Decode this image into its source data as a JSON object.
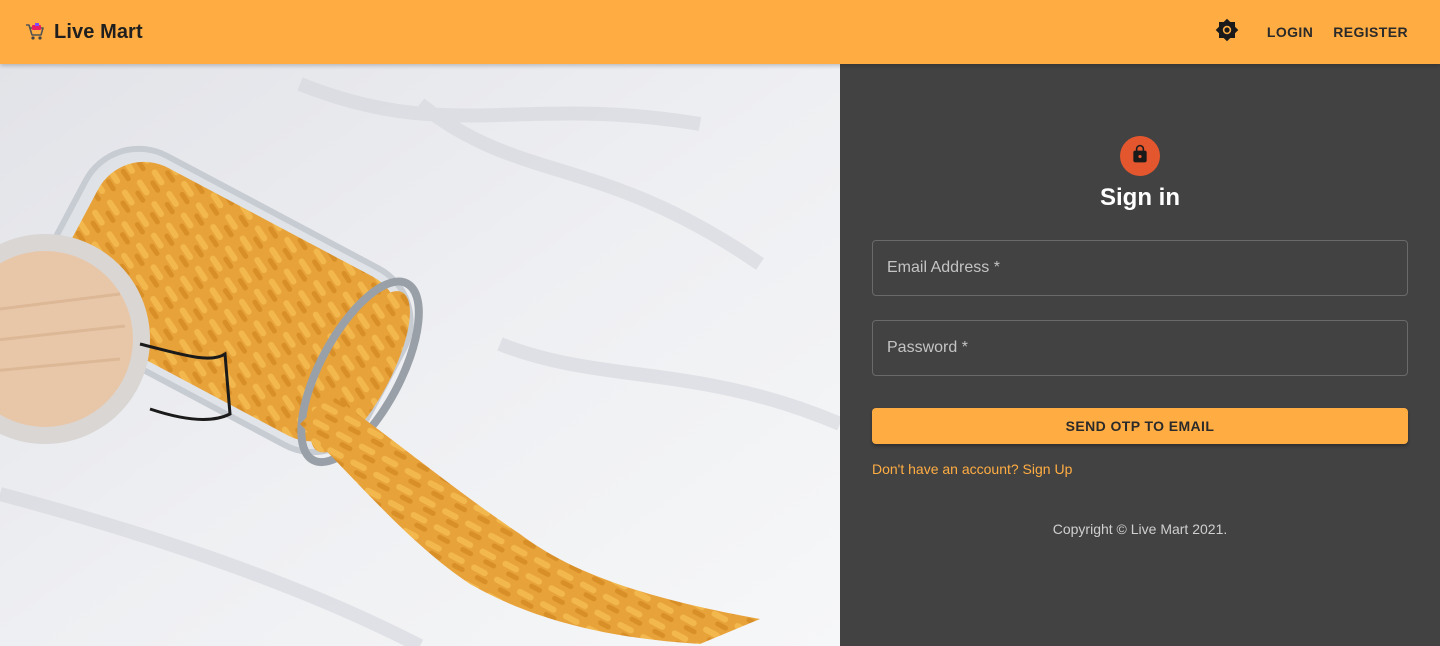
{
  "appbar": {
    "title": "Live Mart",
    "logo_icon": "shopping-cart-icon",
    "theme_icon": "brightness-icon",
    "login_label": "LOGIN",
    "register_label": "REGISTER",
    "color": "#ffad42"
  },
  "hero": {
    "image": "pasta-jar-photo"
  },
  "signin": {
    "lock_icon": "lock-icon",
    "heading": "Sign in",
    "email_placeholder": "Email Address *",
    "password_placeholder": "Password *",
    "submit_label": "SEND OTP TO EMAIL",
    "signup_link": "Don't have an account? Sign Up",
    "copyright": "Copyright © Live Mart 2021.",
    "accent": "#ffad42",
    "avatar_color": "#e4572e"
  }
}
